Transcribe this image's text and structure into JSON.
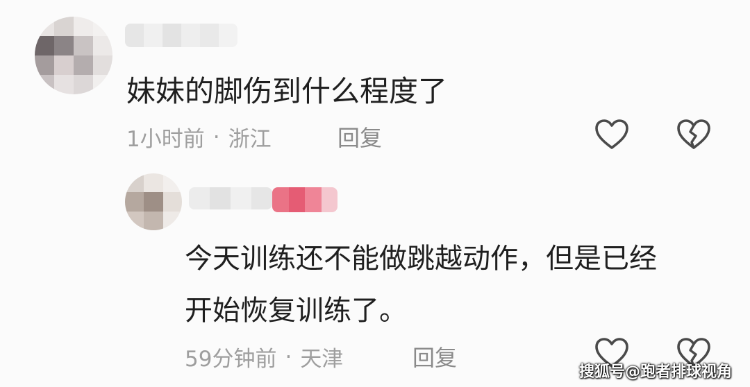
{
  "comment": {
    "text": "妹妹的脚伤到什么程度了",
    "time": "1小时前",
    "separator": "·",
    "location": "浙江",
    "reply_label": "回复"
  },
  "reply": {
    "text_line1": "今天训练还不能做跳越动作，但是已经",
    "text_line2": "开始恢复训练了。",
    "time": "59分钟前",
    "separator": "·",
    "location": "天津",
    "reply_label": "回复"
  },
  "colors": {
    "text_primary": "#1f1f1f",
    "text_meta": "#9e9e9e",
    "icon_stroke": "#4a4a4a",
    "badge_pink": "#e8627a"
  },
  "icons": [
    "heart-icon",
    "broken-heart-icon"
  ],
  "watermark": "搜狐号@跑者排球视角"
}
